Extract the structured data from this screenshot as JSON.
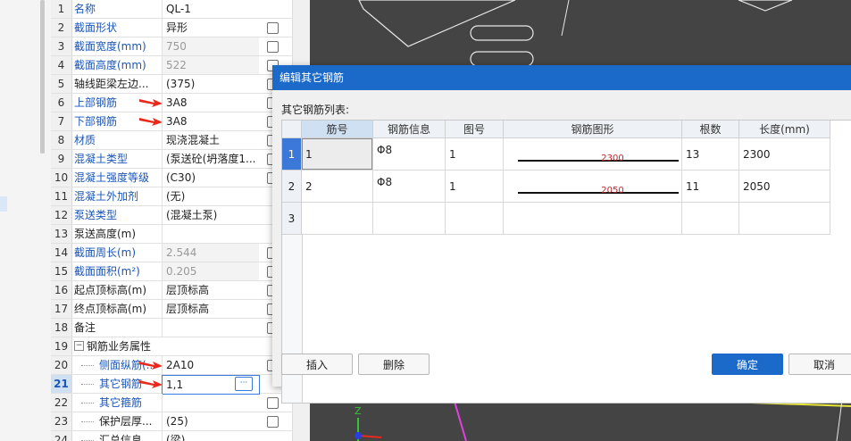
{
  "properties": {
    "rows": [
      {
        "num": "1",
        "name": "名称",
        "value": "QL-1",
        "name_blue": true,
        "value_gray": false,
        "checkbox": false
      },
      {
        "num": "2",
        "name": "截面形状",
        "value": "异形",
        "name_blue": true,
        "value_gray": false,
        "checkbox": true
      },
      {
        "num": "3",
        "name": "截面宽度(mm)",
        "value": "750",
        "name_blue": true,
        "value_gray": true,
        "checkbox": true
      },
      {
        "num": "4",
        "name": "截面高度(mm)",
        "value": "522",
        "name_blue": true,
        "value_gray": true,
        "checkbox": true
      },
      {
        "num": "5",
        "name": "轴线距梁左边...",
        "value": "(375)",
        "name_blue": false,
        "value_gray": false,
        "checkbox": true
      },
      {
        "num": "6",
        "name": "上部钢筋",
        "value": "3A8",
        "name_blue": true,
        "value_gray": false,
        "checkbox": true
      },
      {
        "num": "7",
        "name": "下部钢筋",
        "value": "3A8",
        "name_blue": true,
        "value_gray": false,
        "checkbox": true
      },
      {
        "num": "8",
        "name": "材质",
        "value": "现浇混凝土",
        "name_blue": true,
        "value_gray": false,
        "checkbox": true
      },
      {
        "num": "9",
        "name": "混凝土类型",
        "value": "(泵送砼(坍落度1...",
        "name_blue": true,
        "value_gray": false,
        "checkbox": true
      },
      {
        "num": "10",
        "name": "混凝土强度等级",
        "value": "(C30)",
        "name_blue": true,
        "value_gray": false,
        "checkbox": true
      },
      {
        "num": "11",
        "name": "混凝土外加剂",
        "value": "(无)",
        "name_blue": true,
        "value_gray": false,
        "checkbox": false
      },
      {
        "num": "12",
        "name": "泵送类型",
        "value": "(混凝土泵)",
        "name_blue": true,
        "value_gray": false,
        "checkbox": false
      },
      {
        "num": "13",
        "name": "泵送高度(m)",
        "value": "",
        "name_blue": false,
        "value_gray": false,
        "checkbox": false
      },
      {
        "num": "14",
        "name": "截面周长(m)",
        "value": "2.544",
        "name_blue": true,
        "value_gray": true,
        "checkbox": true
      },
      {
        "num": "15",
        "name": "截面面积(m²)",
        "value": "0.205",
        "name_blue": true,
        "value_gray": true,
        "checkbox": true
      },
      {
        "num": "16",
        "name": "起点顶标高(m)",
        "value": "层顶标高",
        "name_blue": false,
        "value_gray": false,
        "checkbox": true
      },
      {
        "num": "17",
        "name": "终点顶标高(m)",
        "value": "层顶标高",
        "name_blue": false,
        "value_gray": false,
        "checkbox": true
      },
      {
        "num": "18",
        "name": "备注",
        "value": "",
        "name_blue": false,
        "value_gray": false,
        "checkbox": true
      },
      {
        "num": "19",
        "name": "钢筋业务属性",
        "value": "",
        "name_blue": false,
        "value_gray": false,
        "checkbox": false,
        "group": true
      },
      {
        "num": "20",
        "name": "侧面纵筋(...",
        "value": "2A10",
        "name_blue": true,
        "value_gray": false,
        "checkbox": true,
        "indent": true
      },
      {
        "num": "21",
        "name": "其它钢筋",
        "value": "1,1",
        "name_blue": true,
        "value_gray": false,
        "checkbox": false,
        "indent": true,
        "active": true
      },
      {
        "num": "22",
        "name": "其它箍筋",
        "value": "",
        "name_blue": true,
        "value_gray": false,
        "checkbox": true,
        "indent": true
      },
      {
        "num": "23",
        "name": "保护层厚...",
        "value": "(25)",
        "name_blue": false,
        "value_gray": false,
        "checkbox": true,
        "indent": true
      },
      {
        "num": "24",
        "name": "汇总信息",
        "value": "(梁)",
        "name_blue": false,
        "value_gray": false,
        "checkbox": false,
        "indent": true
      }
    ],
    "group_toggle": "−",
    "ellipsis": "···"
  },
  "dialog": {
    "title": "编辑其它钢筋",
    "list_label": "其它钢筋列表:",
    "columns": [
      "筋号",
      "钢筋信息",
      "图号",
      "钢筋图形",
      "根数",
      "长度(mm)"
    ],
    "rows": [
      {
        "row_num": "1",
        "bar_no": "1",
        "bar_info": "Φ8",
        "fig_no": "1",
        "shape_length": "2300",
        "count": "13",
        "length": "2300"
      },
      {
        "row_num": "2",
        "bar_no": "2",
        "bar_info": "Φ8",
        "fig_no": "1",
        "shape_length": "2050",
        "count": "11",
        "length": "2050"
      },
      {
        "row_num": "3",
        "bar_no": "",
        "bar_info": "",
        "fig_no": "",
        "shape_length": "",
        "count": "",
        "length": ""
      }
    ],
    "buttons": {
      "insert": "插入",
      "delete": "删除",
      "ok": "确定",
      "cancel": "取消"
    }
  },
  "colors": {
    "accent": "#1b6ac9",
    "name_blue": "#1a56b8",
    "shape_red": "#c0262b",
    "arrow_red": "#e8291c",
    "cad_bg": "#444444",
    "cad_magenta": "#e040e0",
    "cad_yellow": "#e8e83a"
  },
  "cad_axis": {
    "z_label": "Z"
  }
}
